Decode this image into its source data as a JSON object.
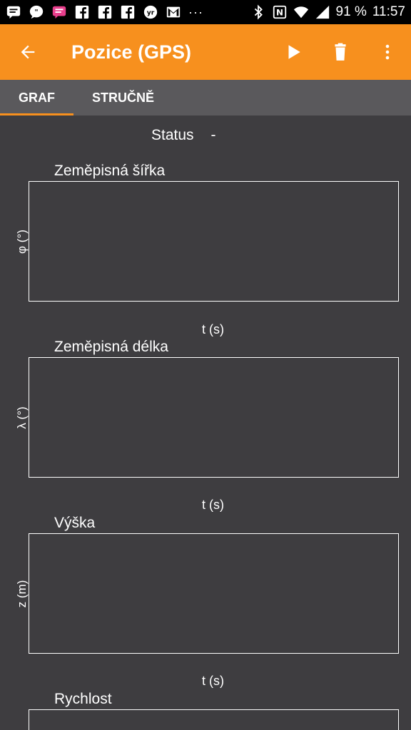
{
  "status_bar": {
    "battery": "91 %",
    "time": "11:57",
    "notification_icons": [
      "message-icon",
      "chat-bubble-icon",
      "sms-icon",
      "facebook-icon",
      "facebook-icon",
      "facebook-icon",
      "yr-icon",
      "gmail-icon"
    ],
    "overflow": "···"
  },
  "app_bar": {
    "title": "Pozice (GPS)",
    "accent_color": "#f7901e"
  },
  "tabs": [
    {
      "label": "GRAF",
      "active": true
    },
    {
      "label": "STRUČNĚ",
      "active": false
    }
  ],
  "status": {
    "label": "Status",
    "value": "-"
  },
  "graphs": [
    {
      "title": "Zeměpisná šířka",
      "ylabel": "φ (°)",
      "xlabel": "t (s)"
    },
    {
      "title": "Zeměpisná délka",
      "ylabel": "λ (°)",
      "xlabel": "t (s)"
    },
    {
      "title": "Výška",
      "ylabel": "z (m)",
      "xlabel": "t (s)"
    },
    {
      "title": "Rychlost",
      "ylabel": "",
      "xlabel": ""
    }
  ]
}
